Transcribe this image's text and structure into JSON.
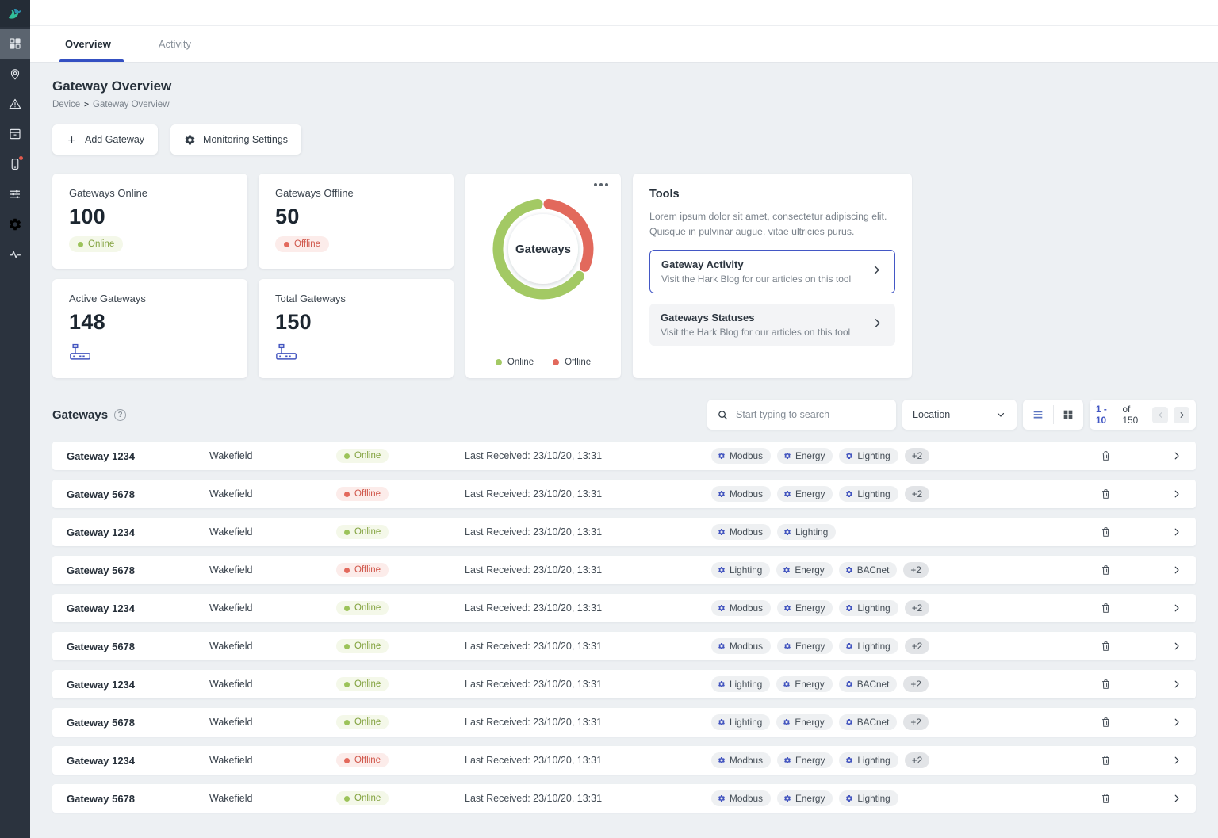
{
  "sidebar": {
    "items": [
      {
        "icon": "hark-bird-logo",
        "label": "logo",
        "active": false,
        "notification": false
      },
      {
        "icon": "dashboard-grid",
        "label": "dashboard",
        "active": true,
        "notification": false
      },
      {
        "icon": "map-pin",
        "label": "locations",
        "active": false,
        "notification": false
      },
      {
        "icon": "warning-triangle",
        "label": "alerts",
        "active": false,
        "notification": false
      },
      {
        "icon": "archive-box",
        "label": "archive",
        "active": false,
        "notification": false
      },
      {
        "icon": "device",
        "label": "devices",
        "active": false,
        "notification": true
      },
      {
        "icon": "sliders",
        "label": "filters",
        "active": false,
        "notification": false
      },
      {
        "icon": "gear",
        "label": "settings",
        "active": false,
        "notification": false
      },
      {
        "icon": "pulse",
        "label": "activity",
        "active": false,
        "notification": false
      }
    ]
  },
  "tabs": [
    {
      "label": "Overview",
      "active": true
    },
    {
      "label": "Activity",
      "active": false
    }
  ],
  "page": {
    "title": "Gateway Overview",
    "breadcrumb": {
      "parent": "Device",
      "separator": ">",
      "current": "Gateway Overview"
    }
  },
  "actions": {
    "add_gateway": "Add Gateway",
    "monitoring_settings": "Monitoring Settings"
  },
  "stats": [
    {
      "label": "Gateways Online",
      "value": "100",
      "badge": "Online",
      "badge_type": "online"
    },
    {
      "label": "Gateways Offline",
      "value": "50",
      "badge": "Offline",
      "badge_type": "offline"
    },
    {
      "label": "Active Gateways",
      "value": "148",
      "icon": "router-icon"
    },
    {
      "label": "Total Gateways",
      "value": "150",
      "icon": "router-icon"
    }
  ],
  "chart_data": {
    "type": "pie",
    "variant": "donut",
    "center_label": "Gateways",
    "series": [
      {
        "name": "Online",
        "value": 100,
        "color": "#a3c964"
      },
      {
        "name": "Offline",
        "value": 50,
        "color": "#e2695c"
      }
    ],
    "total": 150,
    "legend_position": "bottom"
  },
  "tools": {
    "title": "Tools",
    "description": "Lorem ipsum dolor sit amet, consectetur adipiscing elit. Quisque in pulvinar augue, vitae ultricies purus.",
    "items": [
      {
        "title": "Gateway Activity",
        "subtitle": "Visit the Hark Blog for our articles on this tool",
        "highlighted": true
      },
      {
        "title": "Gateways Statuses",
        "subtitle": "Visit the Hark Blog for our articles on this tool",
        "highlighted": false
      }
    ]
  },
  "gateways_section": {
    "title": "Gateways",
    "help_icon": "?",
    "search_placeholder": "Start typing to search",
    "location_filter": "Location",
    "pagination": {
      "range": "1 - 10",
      "of": "of 150"
    }
  },
  "table": {
    "rows": [
      {
        "name": "Gateway 1234",
        "location": "Wakefield",
        "status": "Online",
        "status_type": "online",
        "last_received": "Last Received: 23/10/20, 13:31",
        "tags": [
          "Modbus",
          "Energy",
          "Lighting"
        ],
        "extra": "+2"
      },
      {
        "name": "Gateway 5678",
        "location": "Wakefield",
        "status": "Offline",
        "status_type": "offline",
        "last_received": "Last Received: 23/10/20, 13:31",
        "tags": [
          "Modbus",
          "Energy",
          "Lighting"
        ],
        "extra": "+2"
      },
      {
        "name": "Gateway 1234",
        "location": "Wakefield",
        "status": "Online",
        "status_type": "online",
        "last_received": "Last Received: 23/10/20, 13:31",
        "tags": [
          "Modbus",
          "Lighting"
        ],
        "extra": ""
      },
      {
        "name": "Gateway 5678",
        "location": "Wakefield",
        "status": "Offline",
        "status_type": "offline",
        "last_received": "Last Received: 23/10/20, 13:31",
        "tags": [
          "Lighting",
          "Energy",
          "BACnet"
        ],
        "extra": "+2"
      },
      {
        "name": "Gateway 1234",
        "location": "Wakefield",
        "status": "Online",
        "status_type": "online",
        "last_received": "Last Received: 23/10/20, 13:31",
        "tags": [
          "Modbus",
          "Energy",
          "Lighting"
        ],
        "extra": "+2"
      },
      {
        "name": "Gateway 5678",
        "location": "Wakefield",
        "status": "Online",
        "status_type": "online",
        "last_received": "Last Received: 23/10/20, 13:31",
        "tags": [
          "Modbus",
          "Energy",
          "Lighting"
        ],
        "extra": "+2"
      },
      {
        "name": "Gateway 1234",
        "location": "Wakefield",
        "status": "Online",
        "status_type": "online",
        "last_received": "Last Received: 23/10/20, 13:31",
        "tags": [
          "Lighting",
          "Energy",
          "BACnet"
        ],
        "extra": "+2"
      },
      {
        "name": "Gateway 5678",
        "location": "Wakefield",
        "status": "Online",
        "status_type": "online",
        "last_received": "Last Received: 23/10/20, 13:31",
        "tags": [
          "Lighting",
          "Energy",
          "BACnet"
        ],
        "extra": "+2"
      },
      {
        "name": "Gateway 1234",
        "location": "Wakefield",
        "status": "Offline",
        "status_type": "offline",
        "last_received": "Last Received: 23/10/20, 13:31",
        "tags": [
          "Modbus",
          "Energy",
          "Lighting"
        ],
        "extra": "+2"
      },
      {
        "name": "Gateway 5678",
        "location": "Wakefield",
        "status": "Online",
        "status_type": "online",
        "last_received": "Last Received: 23/10/20, 13:31",
        "tags": [
          "Modbus",
          "Energy",
          "Lighting"
        ],
        "extra": ""
      }
    ]
  }
}
